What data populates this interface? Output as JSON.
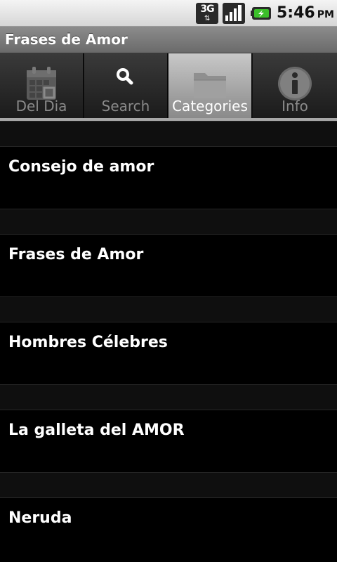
{
  "status_bar": {
    "network": "3G",
    "network_arrows": "⇅",
    "time": "5:46",
    "ampm": "PM"
  },
  "app": {
    "title": "Frases de Amor"
  },
  "tabs": [
    {
      "label": "Del Dia",
      "icon": "calendar-icon",
      "selected": false
    },
    {
      "label": "Search",
      "icon": "search-icon",
      "selected": false
    },
    {
      "label": "Categories",
      "icon": "folder-icon",
      "selected": true
    },
    {
      "label": "Info",
      "icon": "info-icon",
      "selected": false
    }
  ],
  "categories": [
    {
      "label": "Consejo de amor"
    },
    {
      "label": "Frases de Amor"
    },
    {
      "label": "Hombres Célebres"
    },
    {
      "label": "La galleta del AMOR"
    },
    {
      "label": "Neruda"
    }
  ],
  "colors": {
    "battery_green": "#3bbf2a",
    "selected_tab": "#a8a8a8"
  }
}
